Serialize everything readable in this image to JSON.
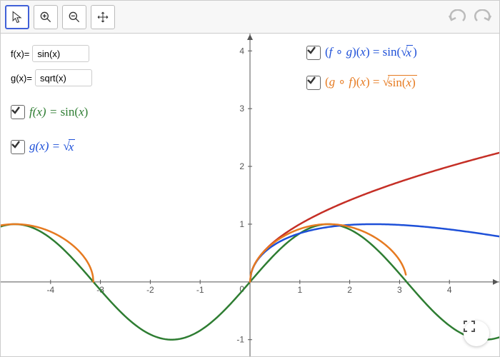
{
  "toolbar": {
    "tools": [
      "pointer",
      "zoom-in",
      "zoom-out",
      "pan"
    ],
    "active": "pointer"
  },
  "inputs": {
    "f": {
      "label": "f(x)=",
      "value": "sin(x)"
    },
    "g": {
      "label": "g(x)=",
      "value": "sqrt(x)"
    }
  },
  "legend": {
    "f": {
      "checked": true,
      "color": "#2e7d32",
      "text_plain": "f(x) = sin(x)"
    },
    "g": {
      "checked": true,
      "color": "#1e50d8",
      "text_plain": "g(x) = √x"
    },
    "fog": {
      "checked": true,
      "color": "#1e50d8",
      "text_plain": "(f ∘ g)(x) = sin(√x)"
    },
    "gof": {
      "checked": true,
      "color": "#e67a20",
      "text_plain": "(g ∘ f)(x) = √(sin(x))"
    }
  },
  "chart_data": {
    "type": "line",
    "xlim": [
      -5,
      5
    ],
    "ylim": [
      -1.3,
      4.3
    ],
    "xticks": [
      -4,
      -3,
      -2,
      -1,
      1,
      2,
      3,
      4
    ],
    "yticks": [
      -1,
      1,
      2,
      3,
      4
    ],
    "origin_label": "0",
    "series": [
      {
        "name": "f(x)=sin(x)",
        "color": "#2e7d32",
        "domain": [
          -5,
          5
        ],
        "formula": "sin(x)"
      },
      {
        "name": "g(x)=sqrt(x)",
        "color": "#c52f26",
        "domain": [
          0,
          5
        ],
        "formula": "sqrt(x)"
      },
      {
        "name": "(f∘g)(x)=sin(√x)",
        "color": "#1e50d8",
        "domain": [
          0,
          5
        ],
        "formula": "sin(sqrt(x))"
      },
      {
        "name": "(g∘f)(x)=√(sin(x))",
        "color": "#e67a20",
        "domain_pieces": [
          [
            -5,
            -3.1416
          ],
          [
            0,
            3.1416
          ]
        ],
        "formula": "sqrt(sin(x))"
      }
    ]
  },
  "colors": {
    "green": "#2e7d32",
    "blue": "#1e50d8",
    "orange": "#e67a20",
    "red": "#c52f26",
    "axis": "#555"
  }
}
